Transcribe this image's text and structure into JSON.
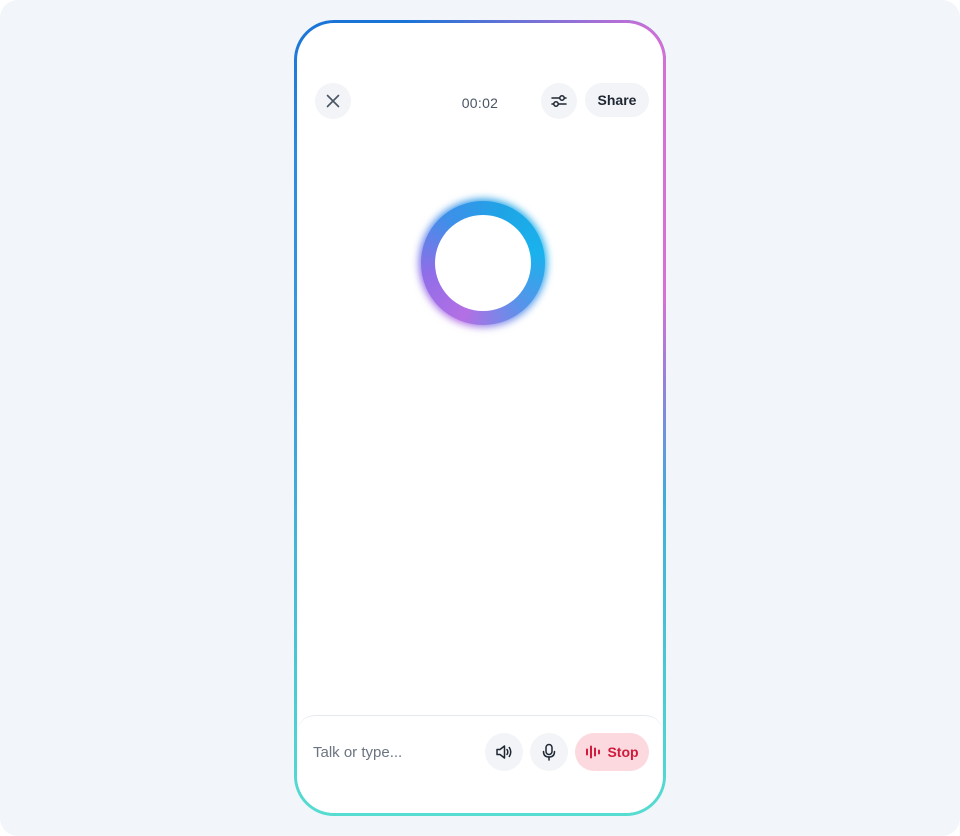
{
  "header": {
    "timer": "00:02",
    "share_label": "Share"
  },
  "icons": {
    "close": "close-icon",
    "settings": "sliders-icon",
    "speaker": "speaker-icon",
    "mic": "microphone-icon",
    "stop": "waveform-icon"
  },
  "composer": {
    "placeholder": "Talk or type...",
    "value": "",
    "stop_label": "Stop"
  },
  "colors": {
    "stop_text": "#d11a3c",
    "stop_background": "#fcd9de",
    "orb_purple": "#b46fe4",
    "orb_blue": "#1ea4e6"
  }
}
